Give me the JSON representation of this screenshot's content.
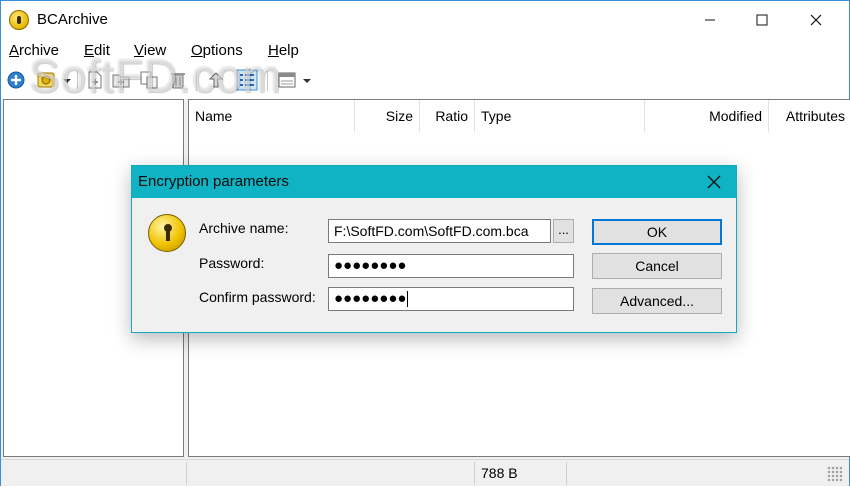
{
  "window": {
    "title": "BCArchive"
  },
  "menu": {
    "items": [
      {
        "label": "Archive",
        "underline": "A",
        "rest": "rchive"
      },
      {
        "label": "Edit",
        "underline": "E",
        "rest": "dit"
      },
      {
        "label": "View",
        "underline": "V",
        "rest": "iew"
      },
      {
        "label": "Options",
        "underline": "O",
        "rest": "ptions"
      },
      {
        "label": "Help",
        "underline": "H",
        "rest": "elp"
      }
    ]
  },
  "toolbar": {
    "icons": [
      "new-archive-icon",
      "open-archive-icon",
      "dropdown-arrow-icon",
      "add-files-icon",
      "add-folder-icon",
      "extract-icon",
      "delete-icon",
      "up-folder-icon",
      "details-view-icon",
      "view-options-icon",
      "dropdown-arrow-icon"
    ]
  },
  "file_list": {
    "columns": [
      "Name",
      "Size",
      "Ratio",
      "Type",
      "Modified",
      "Attributes"
    ]
  },
  "status": {
    "size": "788 B"
  },
  "dialog": {
    "title": "Encryption parameters",
    "archive_name_label": "Archive name:",
    "archive_name_value": "F:\\SoftFD.com\\SoftFD.com.bca",
    "browse_label": "...",
    "password_label": "Password:",
    "password_value": "●●●●●●●●",
    "confirm_label": "Confirm password:",
    "confirm_value": "●●●●●●●●",
    "ok_label": "OK",
    "cancel_label": "Cancel",
    "advanced_label": "Advanced..."
  },
  "watermark": "SoftFD.com",
  "colors": {
    "dialog_title_bar": "#0fb3c4",
    "window_border": "#3a8fd6",
    "default_button_border": "#0078d7"
  }
}
